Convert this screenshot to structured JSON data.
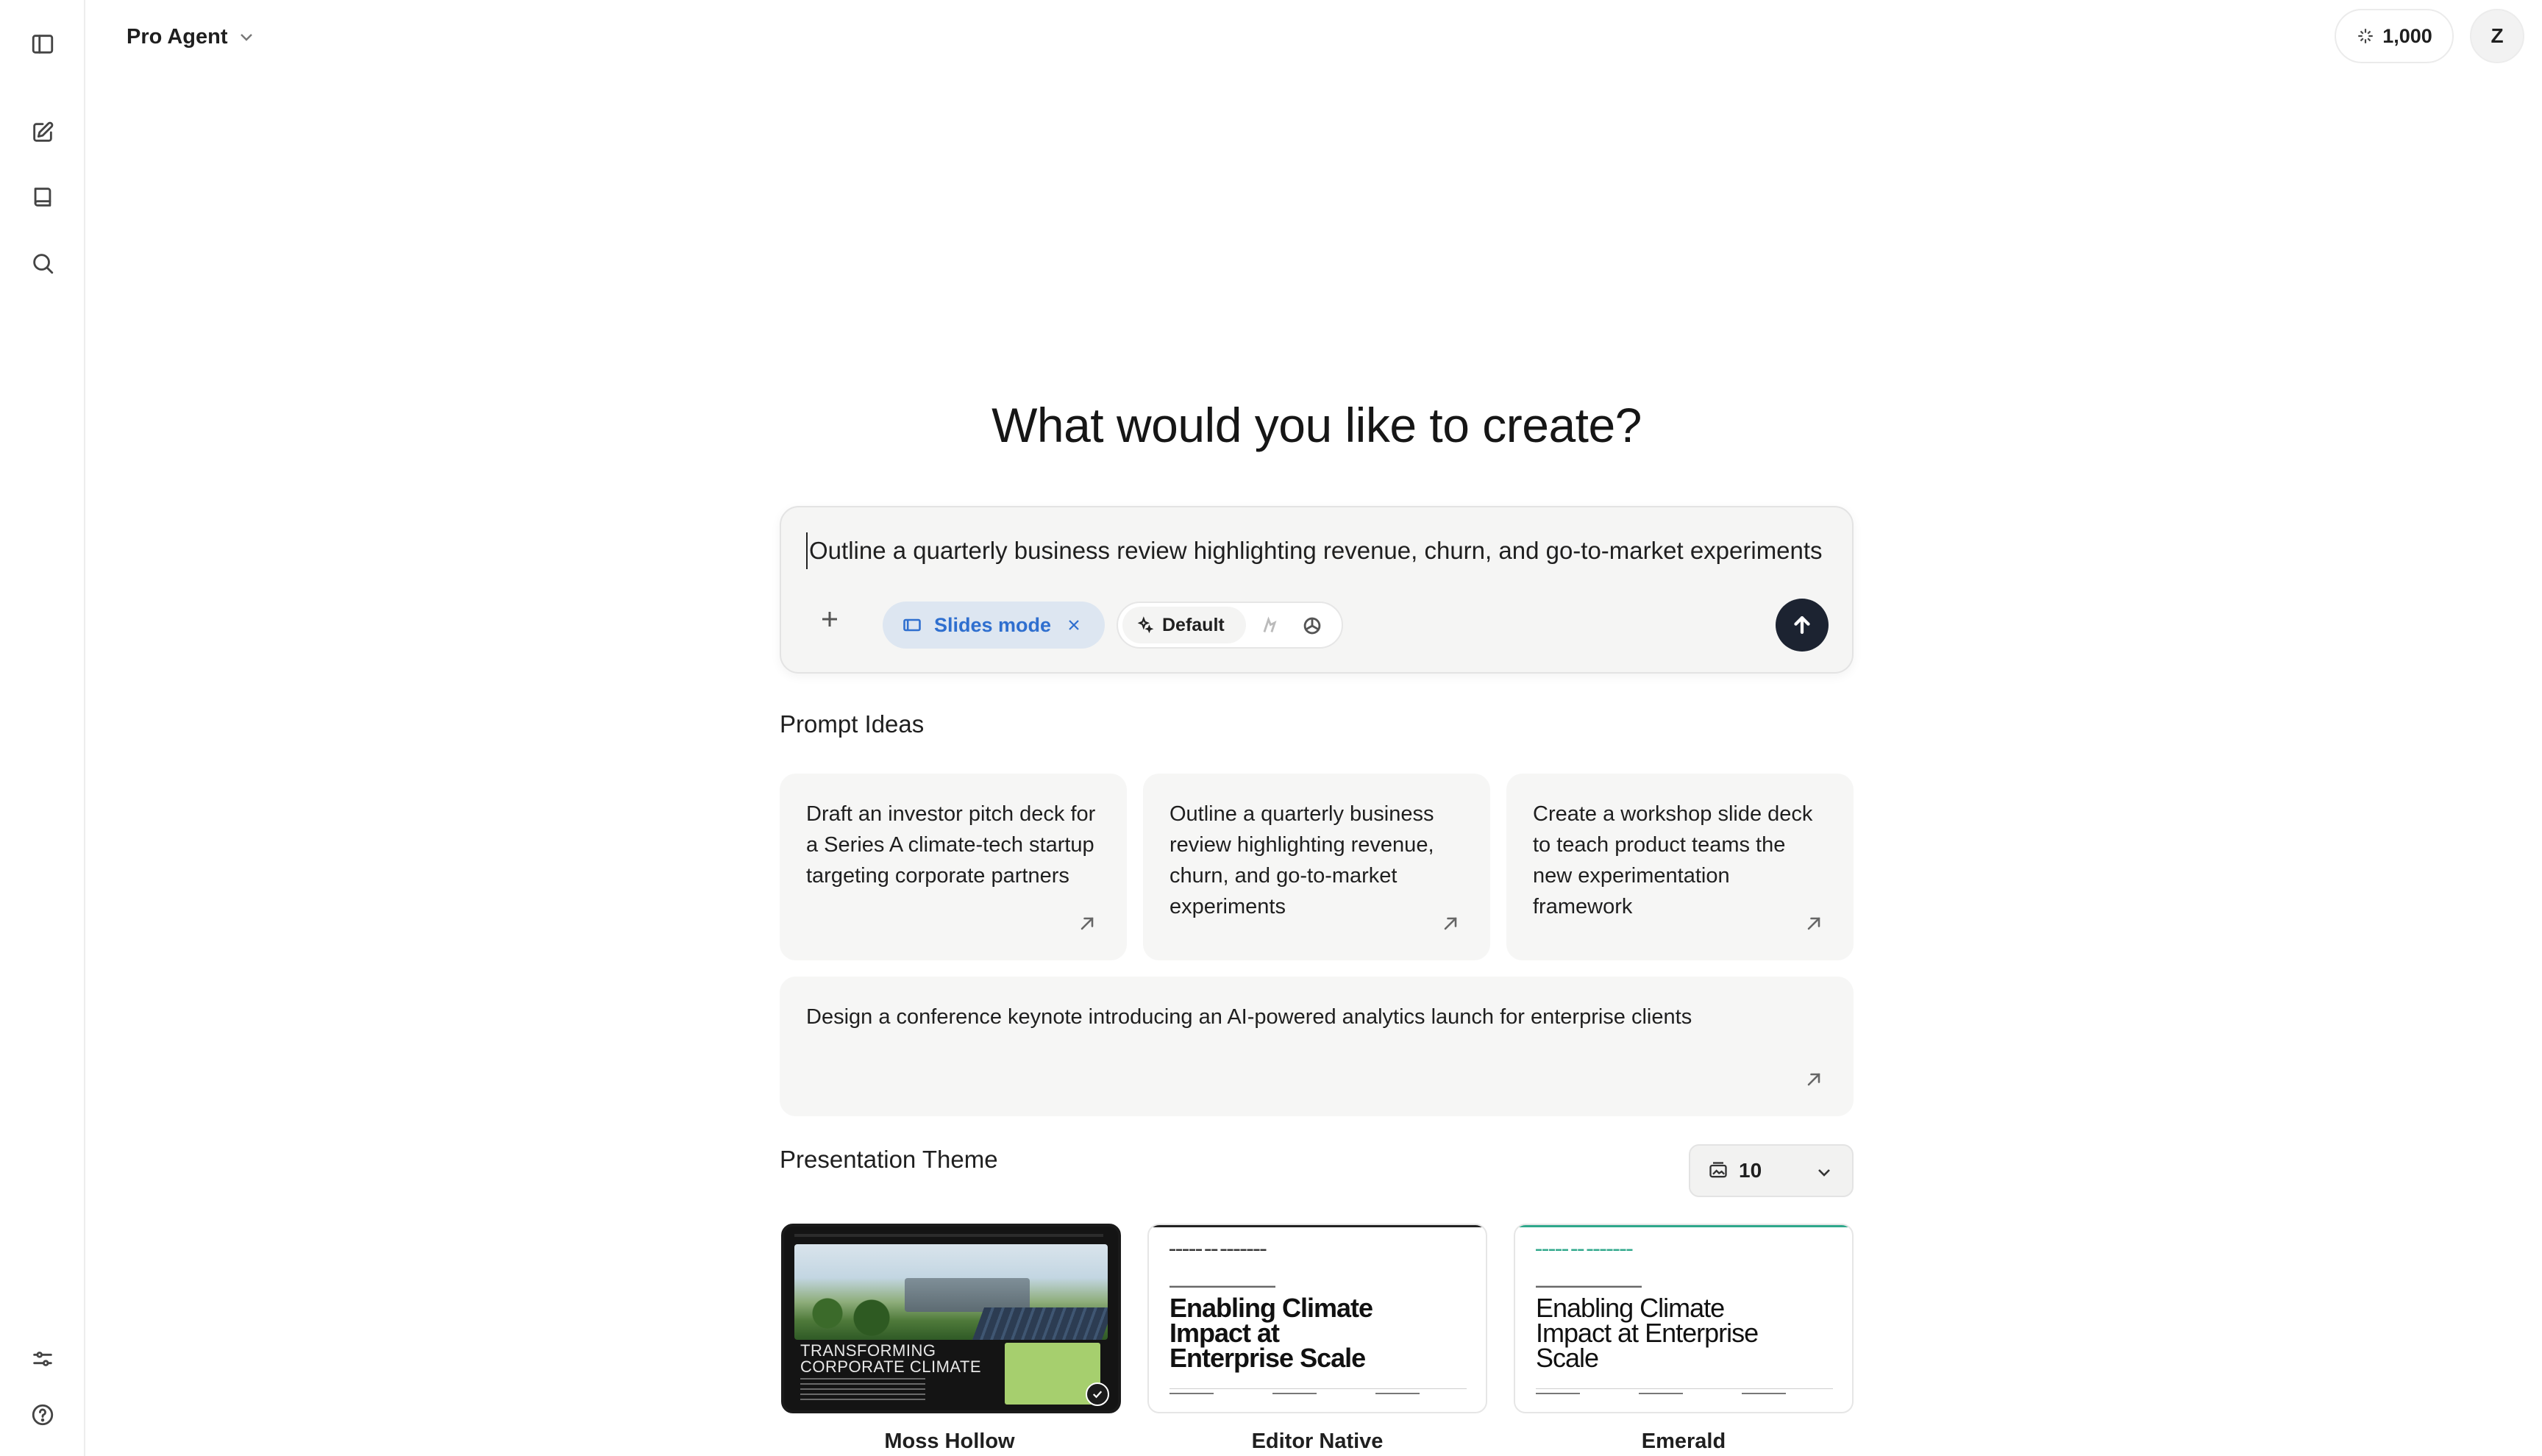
{
  "header": {
    "agent_name": "Pro Agent",
    "credits": "1,000",
    "avatar_initial": "Z"
  },
  "sidebar": {
    "icons": [
      "sidebar-toggle-icon",
      "new-chat-icon",
      "library-icon",
      "search-icon",
      "settings-sliders-icon",
      "help-icon"
    ]
  },
  "main": {
    "headline": "What would you like to create?",
    "composer": {
      "value": "Outline a quarterly business review highlighting revenue, churn, and go-to-market experiments",
      "mode_label": "Slides mode",
      "model_label": "Default"
    },
    "prompt_ideas": {
      "title": "Prompt Ideas",
      "items": [
        "Draft an investor pitch deck for a Series A climate-tech startup targeting corporate partners",
        "Outline a quarterly business review highlighting revenue, churn, and go-to-market experiments",
        "Create a workshop slide deck to teach product teams the new experimentation framework",
        "Design a conference keynote introducing an AI-powered analytics launch for enterprise clients"
      ]
    },
    "themes": {
      "title": "Presentation Theme",
      "slide_count": "10",
      "items": [
        {
          "name": "Moss Hollow",
          "selected": true,
          "preview_title": "TRANSFORMING CORPORATE CLIMATE"
        },
        {
          "name": "Editor Native",
          "selected": false,
          "preview_title": "Enabling Climate Impact at Enterprise Scale"
        },
        {
          "name": "Emerald",
          "selected": false,
          "preview_title": "Enabling Climate Impact at Enterprise Scale"
        }
      ]
    }
  },
  "colors": {
    "accent_blue": "#2f6fcf",
    "send_button": "#1c2331",
    "emerald_accent": "#2fa88b",
    "moss_green": "#a6cf6e"
  }
}
